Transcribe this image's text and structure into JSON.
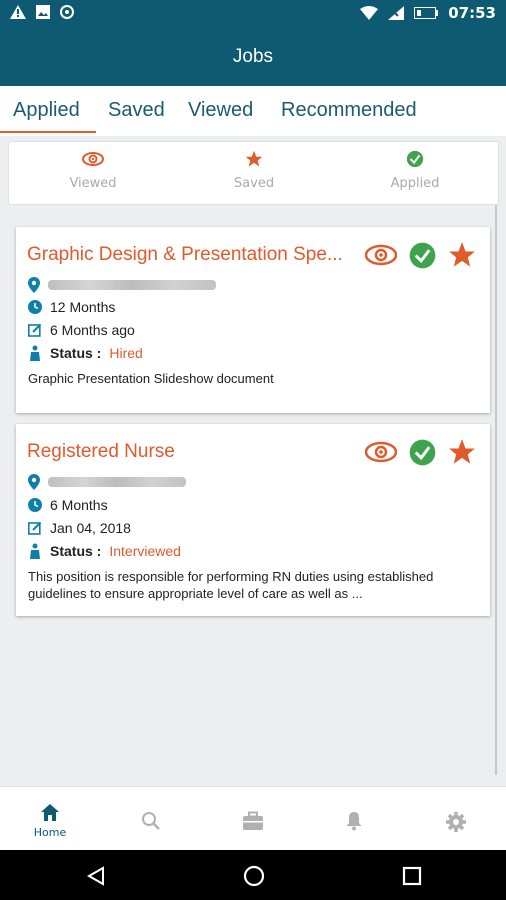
{
  "status_bar": {
    "time": "07:53"
  },
  "app_bar": {
    "title": "Jobs"
  },
  "tabs": [
    "Applied",
    "Saved",
    "Viewed",
    "Recommended"
  ],
  "filters": {
    "viewed": "Viewed",
    "saved": "Saved",
    "applied": "Applied"
  },
  "jobs": [
    {
      "title": "Graphic Design & Presentation Spe...",
      "duration": "12 Months",
      "posted": "6 Months ago",
      "status_label": "Status :",
      "status_value": "Hired",
      "description": "Graphic Presentation Slideshow document"
    },
    {
      "title": "Registered Nurse",
      "duration": "6 Months",
      "posted": "Jan 04, 2018",
      "status_label": "Status :",
      "status_value": "Interviewed",
      "description": "This position is responsible for performing RN duties using established guidelines to ensure appropriate level of care as well as ..."
    }
  ],
  "bottom_nav": {
    "home": "Home"
  },
  "colors": {
    "primary": "#0e5a73",
    "accent": "#e05a2b",
    "success": "#3fa34d"
  }
}
